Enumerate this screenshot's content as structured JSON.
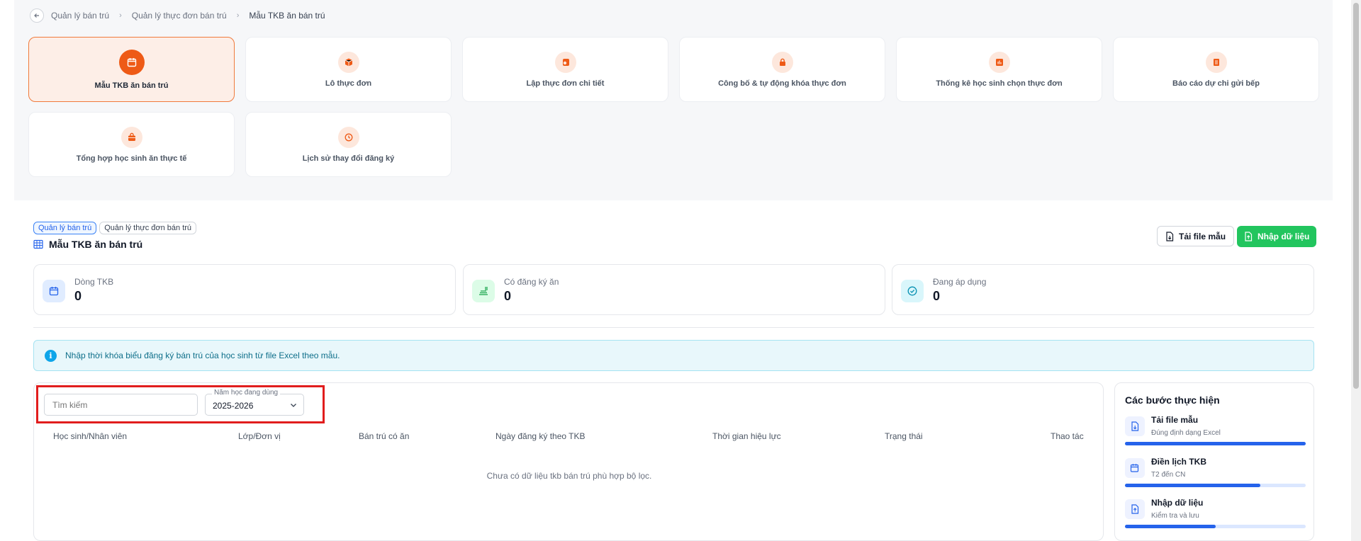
{
  "breadcrumb": {
    "items": [
      "Quản lý bán trú",
      "Quản lý thực đơn bán trú",
      "Mẫu TKB ăn bán trú"
    ]
  },
  "tiles": [
    {
      "label": "Mẫu TKB ăn bán trú",
      "icon": "calendar-icon",
      "active": true
    },
    {
      "label": "Lô thực đơn",
      "icon": "box-icon"
    },
    {
      "label": "Lập thực đơn chi tiết",
      "icon": "recipe-icon"
    },
    {
      "label": "Công bố & tự động khóa thực đơn",
      "icon": "lock-icon"
    },
    {
      "label": "Thống kê học sinh chọn thực đơn",
      "icon": "chart-icon"
    },
    {
      "label": "Báo cáo dự chi gửi bếp",
      "icon": "report-icon"
    },
    {
      "label": "Tổng hợp học sinh ăn thực tế",
      "icon": "bag-icon"
    },
    {
      "label": "Lịch sử thay đổi đăng ký",
      "icon": "history-icon"
    }
  ],
  "section": {
    "pills": [
      "Quản lý bán trú",
      "Quản lý thực đơn bán trú"
    ],
    "title": "Mẫu TKB ăn bán trú"
  },
  "actions": {
    "download_label": "Tải file mẫu",
    "import_label": "Nhập dữ liệu"
  },
  "stats": [
    {
      "label": "Dòng TKB",
      "value": "0",
      "icon": "calendar-icon",
      "color": "#2563eb",
      "bg": "#e0ecff"
    },
    {
      "label": "Có đăng ký ăn",
      "value": "0",
      "icon": "food-icon",
      "color": "#16a34a",
      "bg": "#dcfce7"
    },
    {
      "label": "Đang áp dụng",
      "value": "0",
      "icon": "check-circle-icon",
      "color": "#0891b2",
      "bg": "#d9f6fb"
    }
  ],
  "info": {
    "text": "Nhập thời khóa biểu đăng ký bán trú của học sinh từ file Excel theo mẫu."
  },
  "filters": {
    "search_placeholder": "Tìm kiếm",
    "year_label": "Năm học đang dùng",
    "year_value": "2025-2026"
  },
  "table": {
    "columns": [
      "Học sinh/Nhân viên",
      "Lớp/Đơn vị",
      "Bán trú có ăn",
      "Ngày đăng ký theo TKB",
      "Thời gian hiệu lực",
      "Trạng thái",
      "Thao tác"
    ],
    "empty_text": "Chưa có dữ liệu tkb bán trú phù hợp bộ lọc."
  },
  "steps": {
    "title": "Các bước thực hiện",
    "items": [
      {
        "title": "Tải file mẫu",
        "sub": "Đúng định dạng Excel",
        "progress": 1.0
      },
      {
        "title": "Điền lịch TKB",
        "sub": "T2 đến CN",
        "progress": 0.75
      },
      {
        "title": "Nhập dữ liệu",
        "sub": "Kiểm tra và lưu",
        "progress": 0.5
      }
    ]
  }
}
